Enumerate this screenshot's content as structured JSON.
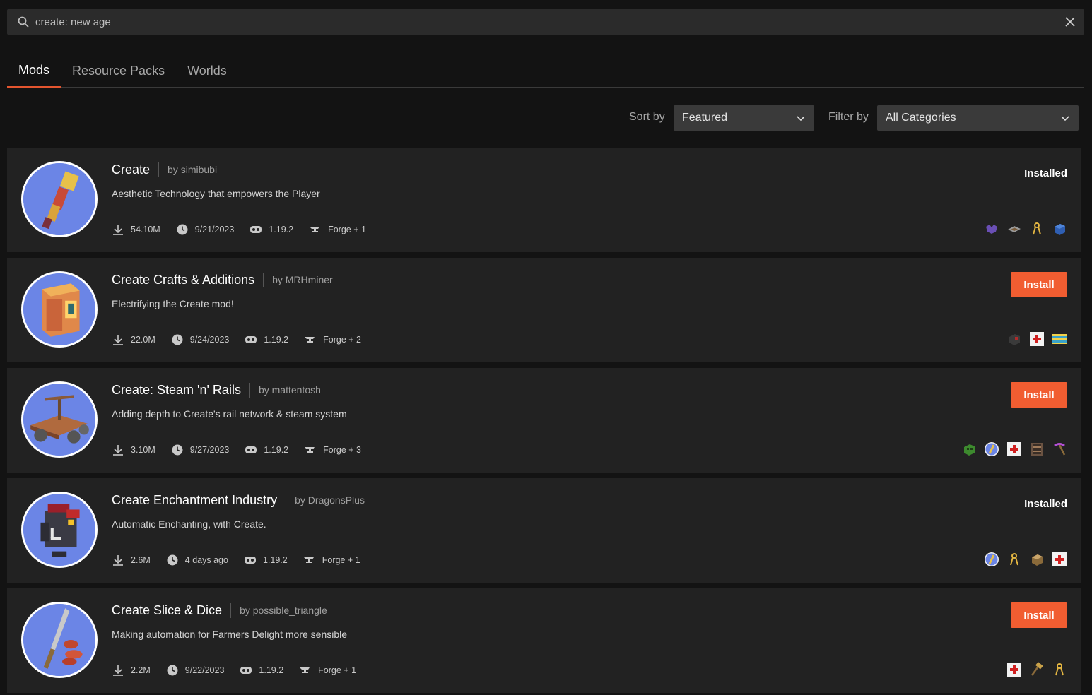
{
  "search": {
    "value": "create: new age"
  },
  "tabs": [
    {
      "label": "Mods",
      "active": true
    },
    {
      "label": "Resource Packs",
      "active": false
    },
    {
      "label": "Worlds",
      "active": false
    }
  ],
  "sort": {
    "label": "Sort by",
    "value": "Featured"
  },
  "filter": {
    "label": "Filter by",
    "value": "All Categories"
  },
  "colors": {
    "accent": "#f15d31",
    "background": "#131313",
    "card": "#222222"
  },
  "mods": [
    {
      "title": "Create",
      "author": "by simibubi",
      "description": "Aesthetic Technology that empowers the Player",
      "downloads": "54.10M",
      "updated": "9/21/2023",
      "game_version": "1.19.2",
      "loader": "Forge + 1",
      "status": "Installed",
      "action": "",
      "dependencies": [
        "ore-icon",
        "rail-icon",
        "tongs-icon",
        "blue-block-icon"
      ]
    },
    {
      "title": "Create Crafts & Additions",
      "author": "by MRHminer",
      "description": "Electrifying the Create mod!",
      "downloads": "22.0M",
      "updated": "9/24/2023",
      "game_version": "1.19.2",
      "loader": "Forge + 2",
      "status": "",
      "action": "Install",
      "dependencies": [
        "redstone-block-icon",
        "red-cross-icon",
        "striped-block-icon"
      ]
    },
    {
      "title": "Create: Steam 'n' Rails",
      "author": "by mattentosh",
      "description": "Adding depth to Create's rail network & steam system",
      "downloads": "3.10M",
      "updated": "9/27/2023",
      "game_version": "1.19.2",
      "loader": "Forge + 3",
      "status": "",
      "action": "Install",
      "dependencies": [
        "green-block-icon",
        "create-logo-icon",
        "red-cross-icon",
        "ladder-icon",
        "pickaxe-icon"
      ]
    },
    {
      "title": "Create Enchantment Industry",
      "author": "by DragonsPlus",
      "description": "Automatic Enchanting, with Create.",
      "downloads": "2.6M",
      "updated": "4 days ago",
      "game_version": "1.19.2",
      "loader": "Forge + 1",
      "status": "Installed",
      "action": "",
      "dependencies": [
        "create-logo-icon",
        "tongs-icon",
        "crate-icon",
        "red-cross-icon"
      ]
    },
    {
      "title": "Create Slice & Dice",
      "author": "by possible_triangle",
      "description": "Making automation for Farmers Delight more sensible",
      "downloads": "2.2M",
      "updated": "9/22/2023",
      "game_version": "1.19.2",
      "loader": "Forge + 1",
      "status": "",
      "action": "Install",
      "dependencies": [
        "red-cross-icon",
        "hammer-icon",
        "tongs-icon"
      ]
    }
  ]
}
